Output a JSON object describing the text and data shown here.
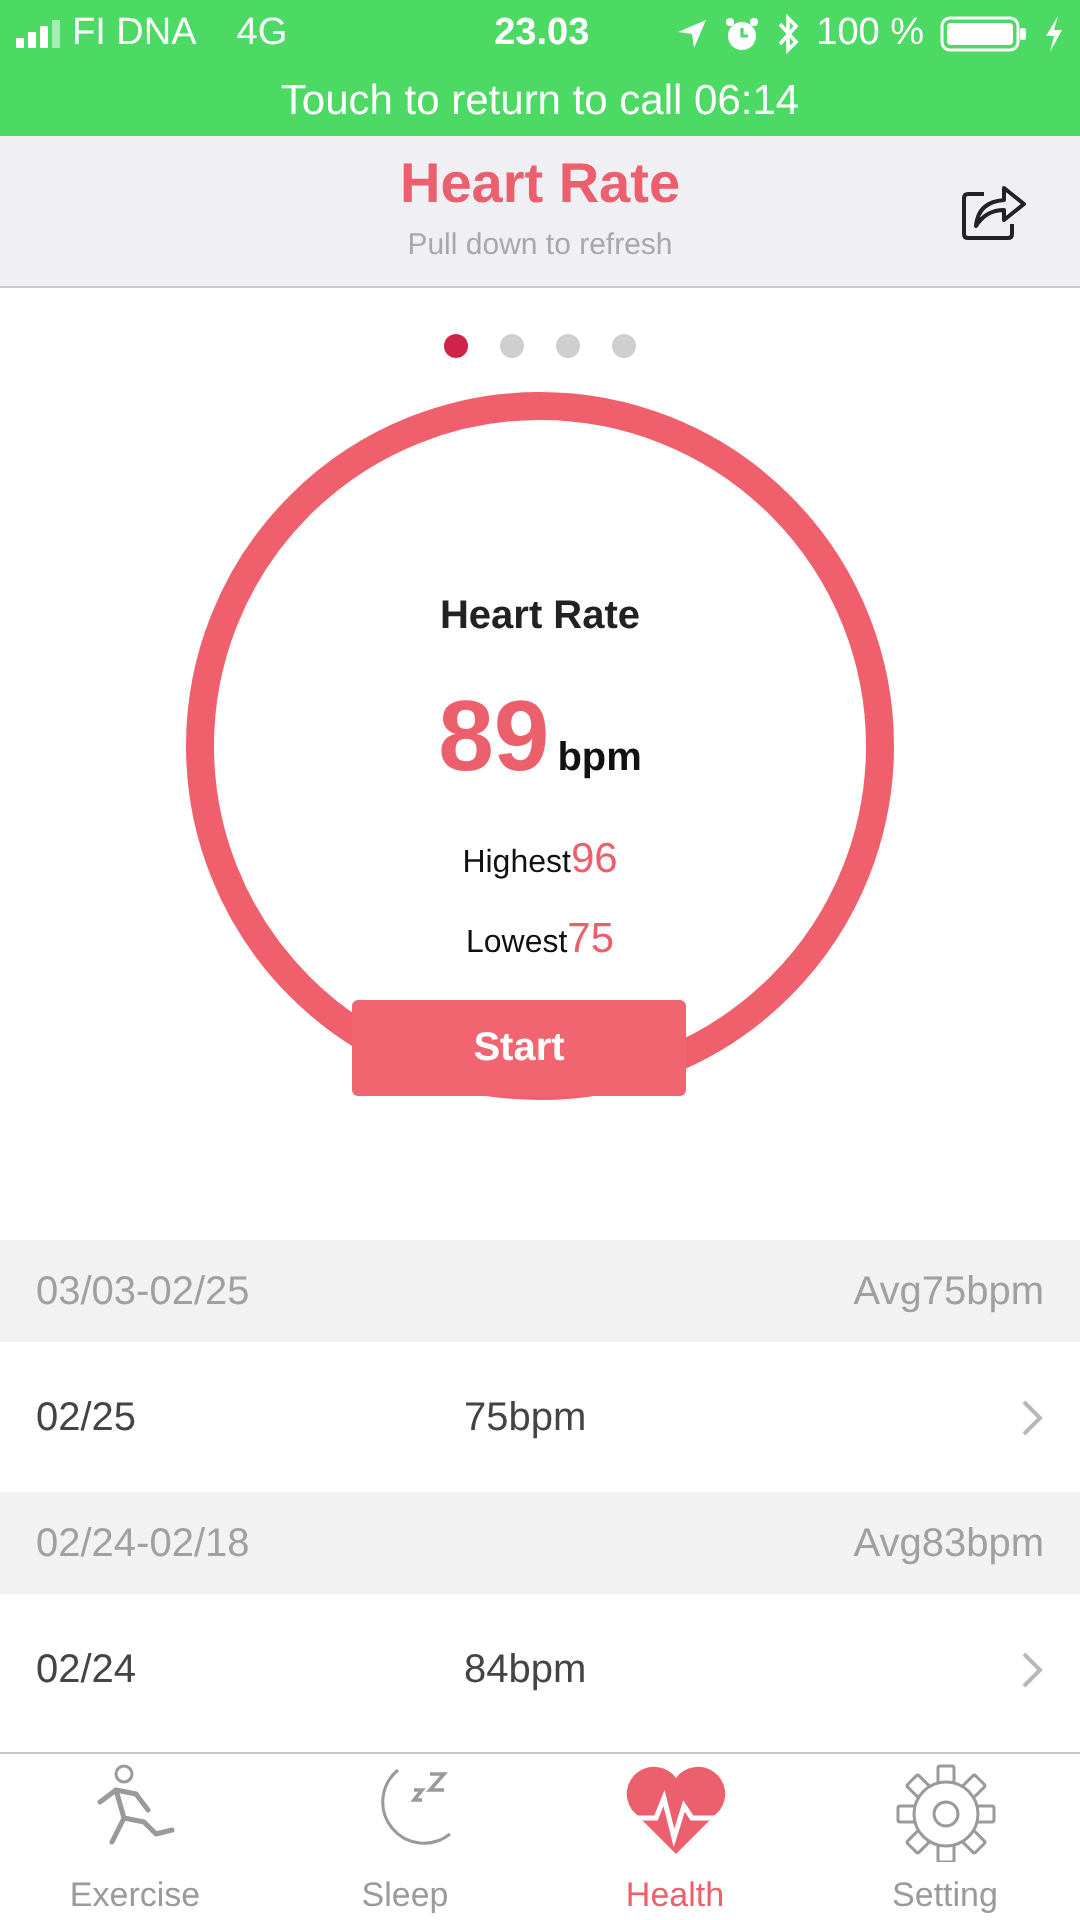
{
  "status_bar": {
    "carrier": "FI DNA",
    "network": "4G",
    "time": "23.03",
    "battery": "100 %"
  },
  "call_banner": {
    "text": "Touch to return to call 06:14"
  },
  "header": {
    "title": "Heart Rate",
    "subtitle": "Pull down to refresh"
  },
  "pager": [
    {
      "selected": true
    },
    {
      "selected": false
    },
    {
      "selected": false
    },
    {
      "selected": false
    }
  ],
  "gauge": {
    "title": "Heart Rate",
    "value": "89",
    "unit": "bpm",
    "highest_label": "Highest",
    "highest_value": "96",
    "lowest_label": "Lowest",
    "lowest_value": "75",
    "button": "Start"
  },
  "history": [
    {
      "kind": "header",
      "date": "03/03-02/25",
      "avg": "Avg75bpm"
    },
    {
      "kind": "row",
      "date": "02/25",
      "value": "75bpm"
    },
    {
      "kind": "header",
      "date": "02/24-02/18",
      "avg": "Avg83bpm"
    },
    {
      "kind": "row",
      "date": "02/24",
      "value": "84bpm"
    }
  ],
  "tabs": [
    {
      "label": "Exercise",
      "selected": false
    },
    {
      "label": "Sleep",
      "selected": false
    },
    {
      "label": "Health",
      "selected": true
    },
    {
      "label": "Setting",
      "selected": false
    }
  ]
}
